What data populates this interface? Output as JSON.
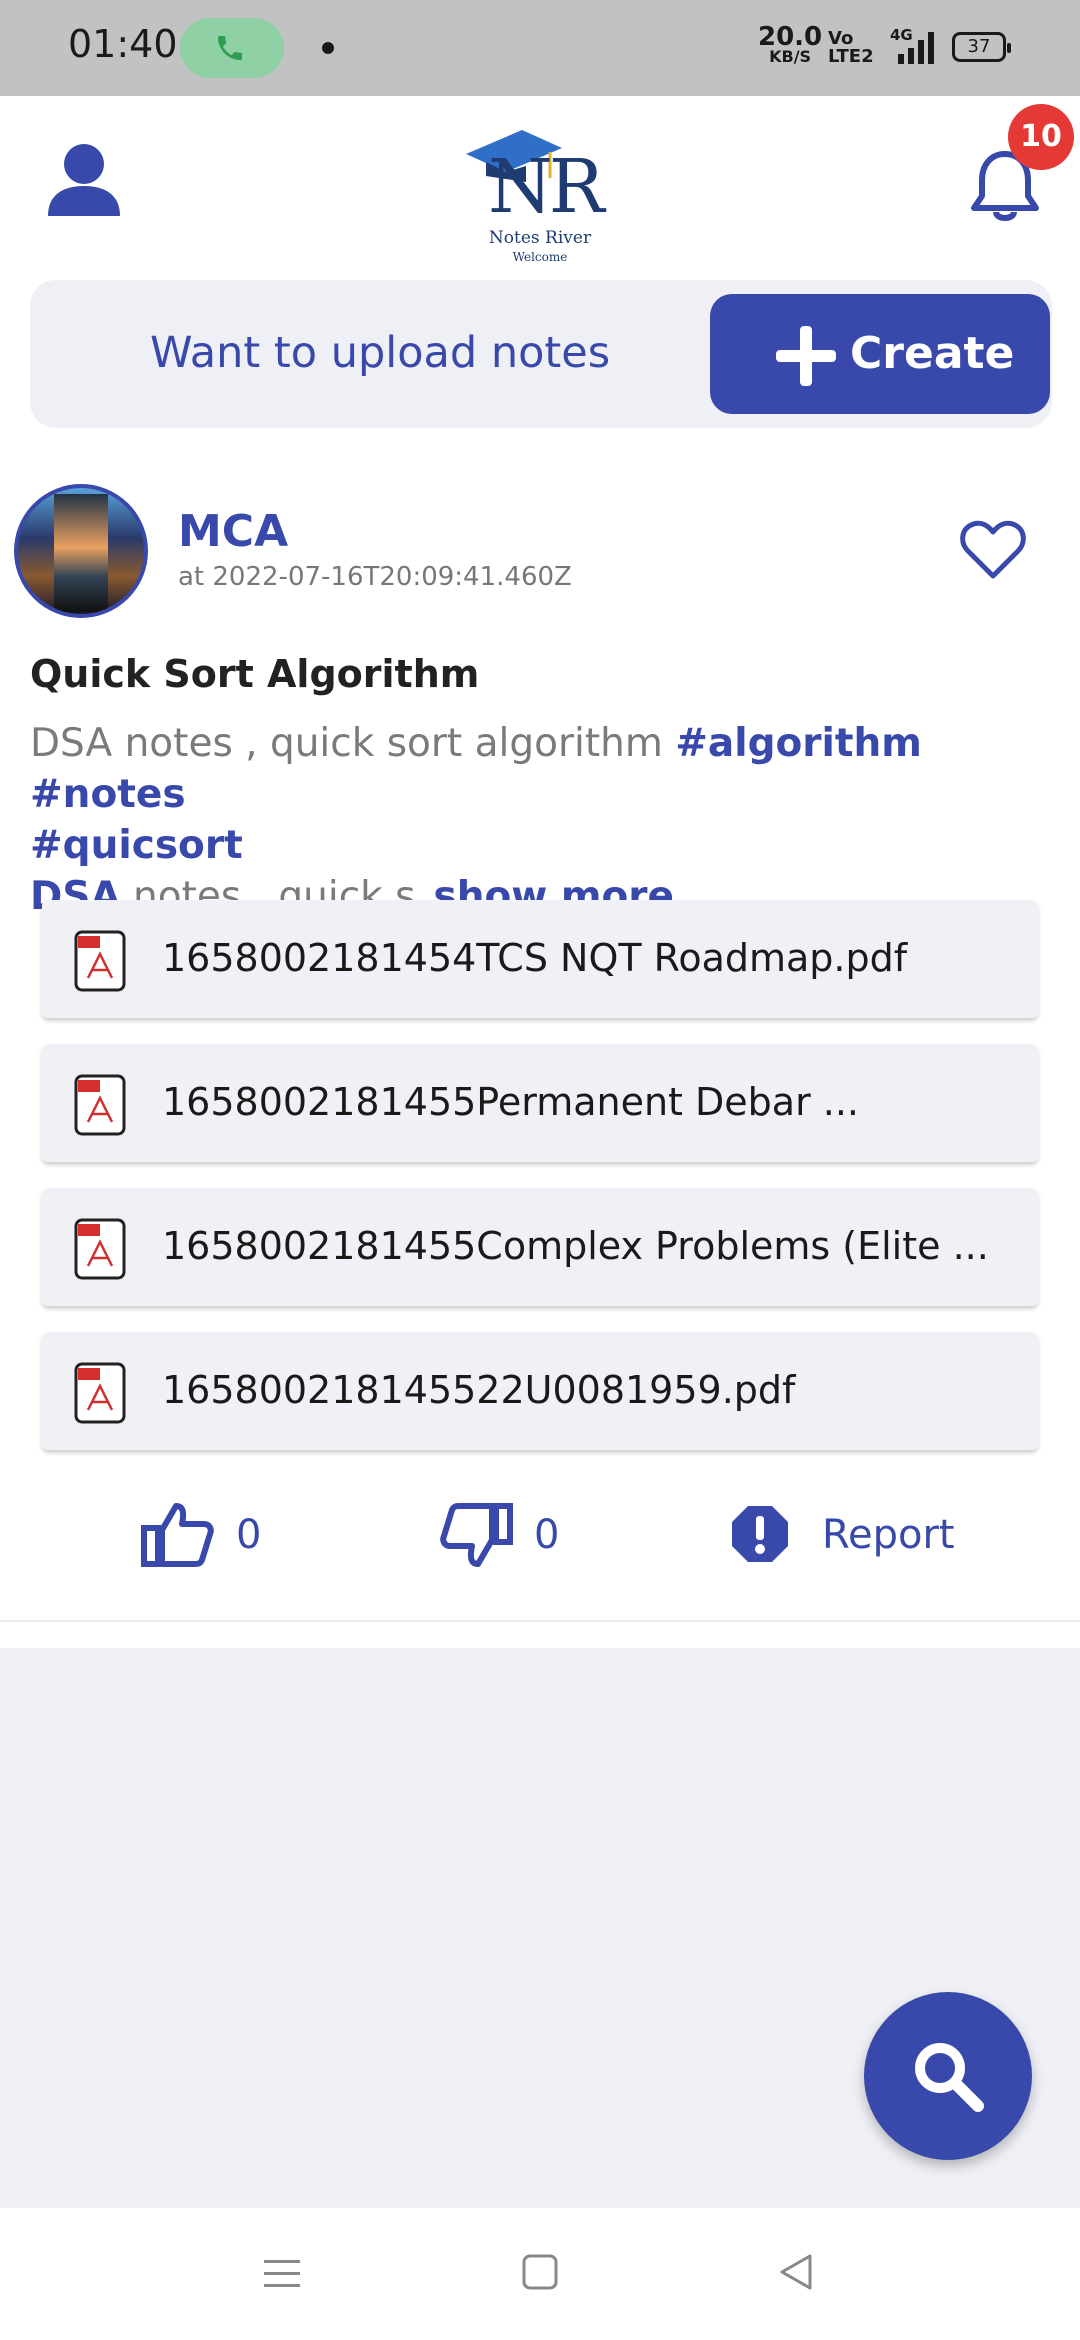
{
  "status_bar": {
    "time": "01:40",
    "net_speed": "20.0",
    "net_unit": "KB/S",
    "volte": "Vo LTE2",
    "signal": "4G",
    "battery": "37"
  },
  "header": {
    "logo_text": "NR",
    "logo_brand": "Notes River",
    "logo_subtitle": "Welcome",
    "notification_count": "10"
  },
  "upload": {
    "prompt": "Want to upload notes",
    "create_label": "Create"
  },
  "post": {
    "author": "MCA",
    "timestamp": "at 2022-07-16T20:09:41.460Z",
    "title": "Quick Sort Algorithm",
    "description_text": "DSA notes , quick sort algorithm ",
    "tags": [
      "#algorithm",
      "#notes",
      "#quicsort"
    ],
    "description_tag2": "DSA",
    "description_tail": " notes , quick s",
    "show_more": "show more",
    "files": [
      "1658002181454TCS NQT Roadmap.pdf",
      "1658002181455Permanent Debar ...",
      "1658002181455Complex Problems (Elite ...",
      "165800218145522U0081959.pdf"
    ],
    "likes": "0",
    "dislikes": "0",
    "report_label": "Report"
  },
  "colors": {
    "accent": "#3949ab",
    "badge": "#e53935",
    "surface": "#eff0f6"
  }
}
